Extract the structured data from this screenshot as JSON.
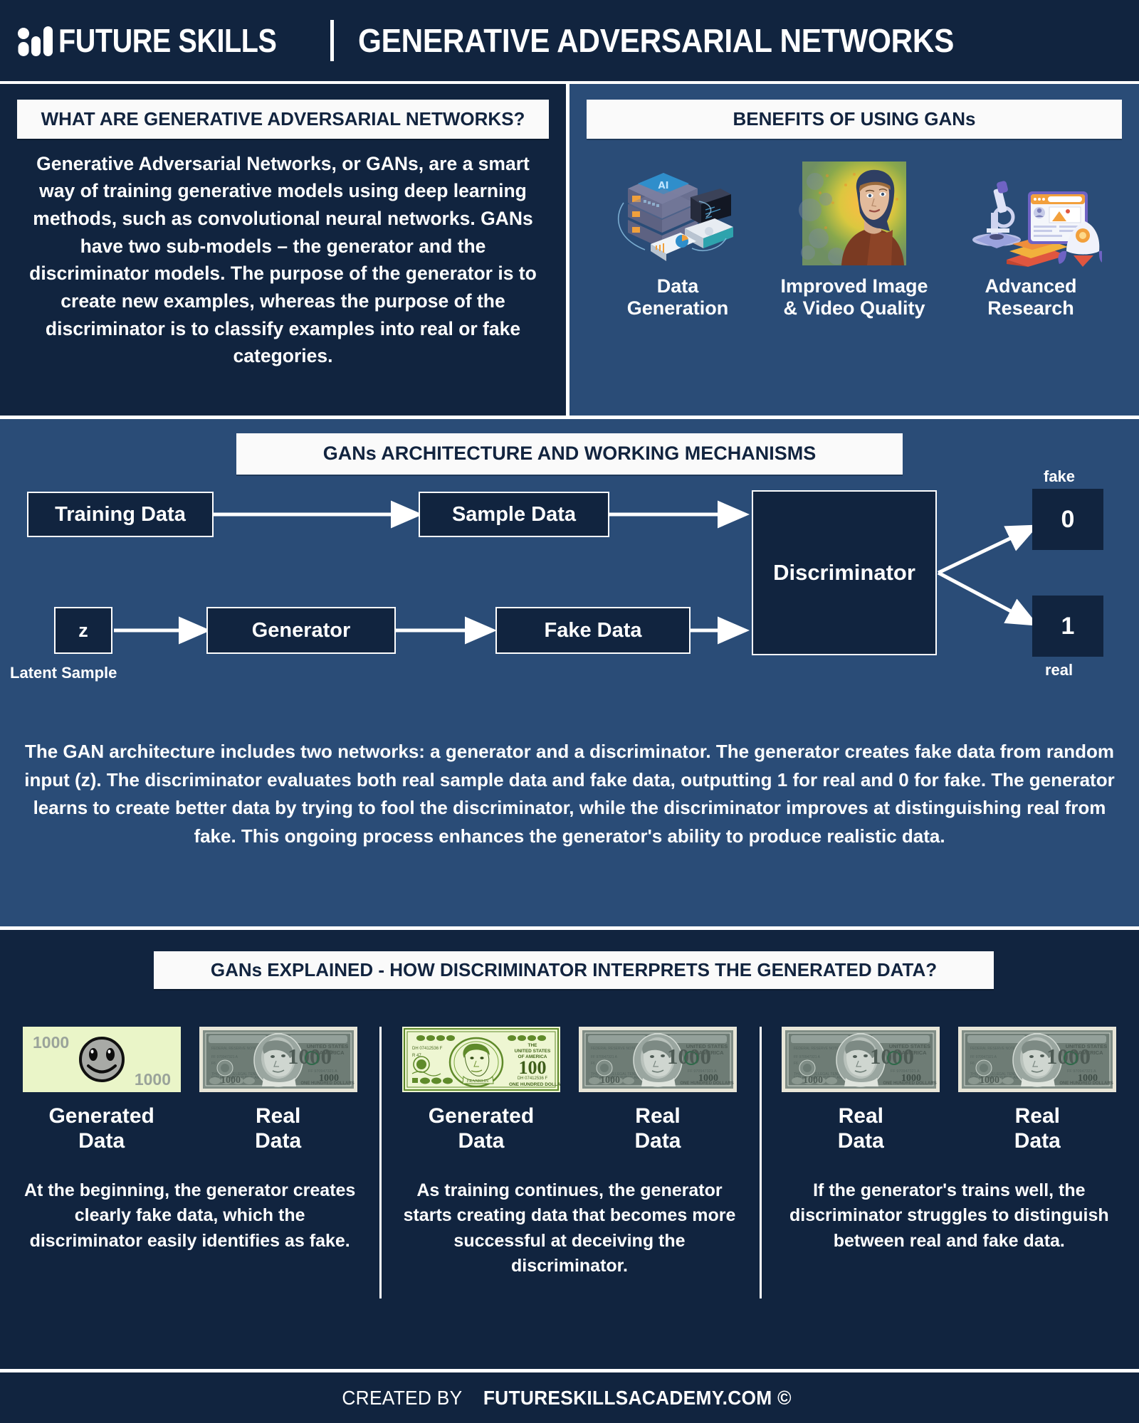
{
  "header": {
    "brand": "FUTURE SKILLS",
    "title": "GENERATIVE ADVERSARIAL NETWORKS",
    "logo_icon": "bar-chart-logo-icon",
    "divider": "|"
  },
  "what_panel": {
    "heading": "WHAT ARE GENERATIVE ADVERSARIAL NETWORKS?",
    "body": "Generative Adversarial Networks, or GANs, are a smart way of training generative models using deep learning methods, such as convolutional neural networks. GANs have two sub-models – the generator and the discriminator models. The purpose of the generator is to create new examples, whereas the purpose of the discriminator is to classify examples into real or fake categories."
  },
  "benefits_panel": {
    "heading": "BENEFITS OF USING GANs",
    "items": [
      {
        "label": "Data\nGeneration",
        "label_line1": "Data",
        "label_line2": "Generation",
        "icon": "server-laptop-analytics-icon"
      },
      {
        "label": "Improved Image\n& Video Quality",
        "label_line1": "Improved Image",
        "label_line2": "& Video Quality",
        "icon": "ai-generated-portrait-icon"
      },
      {
        "label": "Advanced\nResearch",
        "label_line1": "Advanced",
        "label_line2": "Research",
        "icon": "microscope-books-rocket-icon"
      }
    ]
  },
  "architecture": {
    "heading": "GANs ARCHITECTURE AND WORKING MECHANISMS",
    "nodes": {
      "training_data": "Training Data",
      "sample_data": "Sample Data",
      "latent_z": "z",
      "latent_caption": "Latent Sample",
      "generator": "Generator",
      "fake_data": "Fake Data",
      "discriminator": "Discriminator",
      "output_fake_value": "0",
      "output_fake_label": "fake",
      "output_real_value": "1",
      "output_real_label": "real"
    },
    "caption": "The GAN architecture includes two networks: a generator and a discriminator. The generator creates fake data from random input (z). The discriminator evaluates both real sample data and fake data, outputting 1 for real and 0 for fake. The generator learns to create better data by trying to fool the discriminator, while the discriminator improves at distinguishing real from fake. This ongoing process enhances the generator's ability to produce realistic data."
  },
  "explained": {
    "heading": "GANs EXPLAINED - HOW DISCRIMINATOR INTERPRETS THE GENERATED DATA?",
    "columns": [
      {
        "left_bill": {
          "kind": "smiley-note",
          "denomination": "1000",
          "icon": "fake-banknote-smiley-icon"
        },
        "right_bill": {
          "kind": "real-note-gray",
          "denomination": "1000",
          "icon": "real-banknote-icon"
        },
        "left_label_line1": "Generated",
        "left_label_line2": "Data",
        "right_label_line1": "Real",
        "right_label_line2": "Data",
        "caption": "At the beginning, the generator creates clearly fake data, which the discriminator easily identifies as fake."
      },
      {
        "left_bill": {
          "kind": "green-note",
          "denomination": "100",
          "icon": "generated-banknote-green-icon"
        },
        "right_bill": {
          "kind": "real-note-gray",
          "denomination": "1000",
          "icon": "real-banknote-icon"
        },
        "left_label_line1": "Generated",
        "left_label_line2": "Data",
        "right_label_line1": "Real",
        "right_label_line2": "Data",
        "caption": "As training continues, the generator starts creating data that becomes more successful at deceiving the discriminator."
      },
      {
        "left_bill": {
          "kind": "real-note-gray",
          "denomination": "1000",
          "icon": "real-banknote-icon"
        },
        "right_bill": {
          "kind": "real-note-gray",
          "denomination": "1000",
          "icon": "real-banknote-icon"
        },
        "left_label_line1": "Real",
        "left_label_line2": "Data",
        "right_label_line1": "Real",
        "right_label_line2": "Data",
        "caption": "If the generator's trains well, the discriminator struggles to distinguish between real and fake data."
      }
    ]
  },
  "footer": {
    "created_by": "CREATED BY",
    "site": "FUTURESKILLSACADEMY.COM ©"
  },
  "colors": {
    "dark_navy": "#11243f",
    "mid_blue": "#2a4c77",
    "white": "#ffffff",
    "banner_bg": "#fafafa",
    "fake_note_bg": "#eaf5c8",
    "green_note": "#5f8a2a",
    "gray_note": "#6d7a74"
  }
}
